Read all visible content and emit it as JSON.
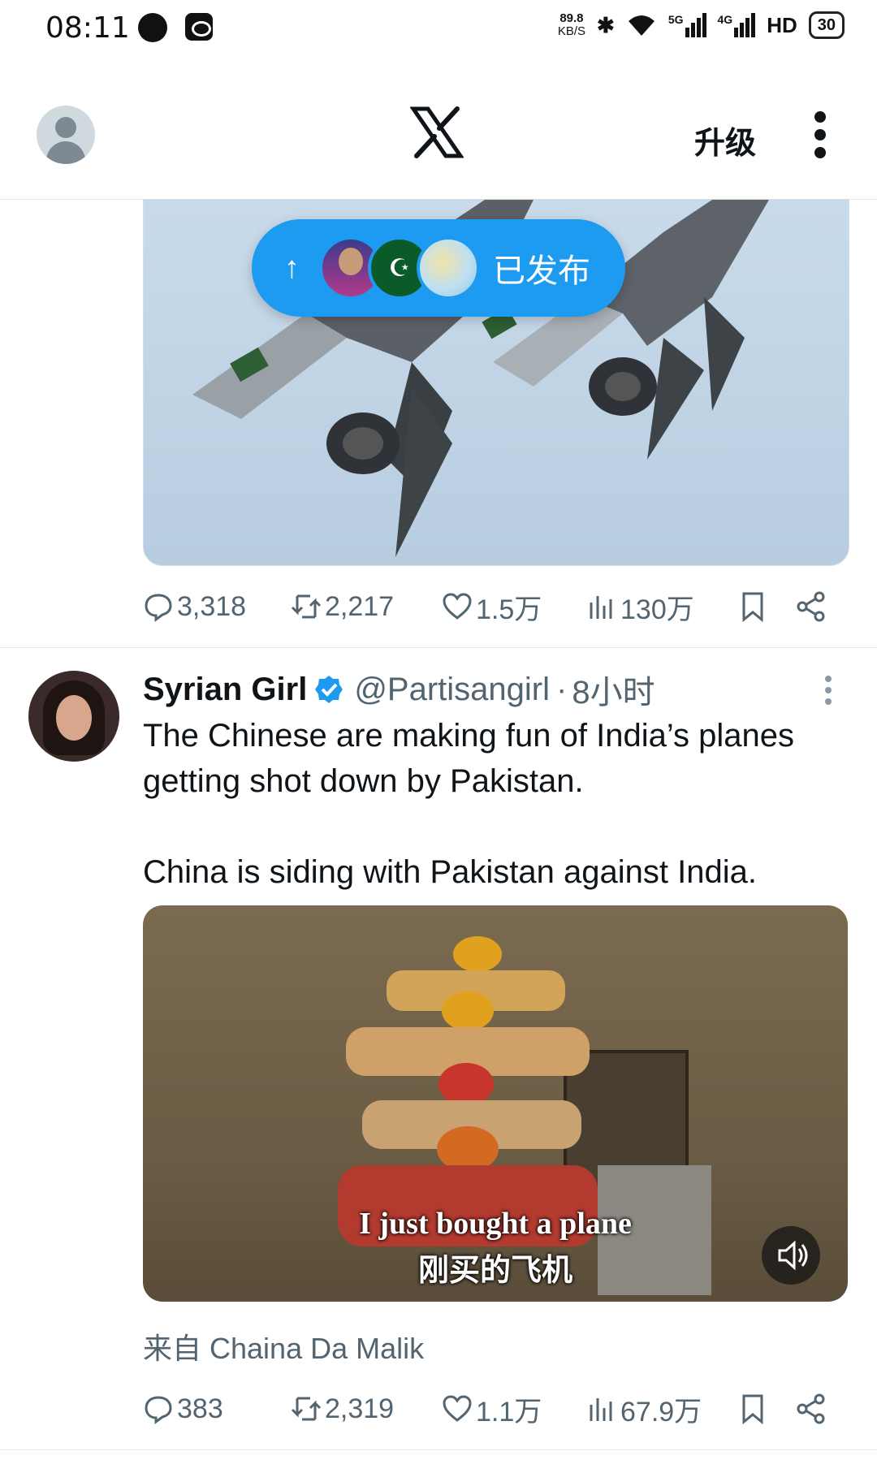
{
  "status_bar": {
    "time": "08:11",
    "net_speed_value": "89.8",
    "net_speed_unit": "KB/S",
    "network_5g": "5G",
    "network_4g": "4G",
    "hd": "HD",
    "battery": "30"
  },
  "header": {
    "upgrade_label": "升级",
    "icons": [
      "avatar-icon",
      "x-logo-icon",
      "more-vertical-icon"
    ]
  },
  "banner": {
    "label": "已发布"
  },
  "tweet1_stats": {
    "replies": "3,318",
    "retweets": "2,217",
    "likes": "1.5万",
    "views": "130万"
  },
  "tweet2": {
    "name": "Syrian Girl",
    "handle": "@Partisangirl",
    "separator": "·",
    "time": "8小时",
    "text_line1": "The Chinese are making fun of India’s planes getting shot down by Pakistan.",
    "text_line2": "China is siding with Pakistan against India.",
    "subtitle_en": "I just bought a plane",
    "subtitle_zh": "刚买的飞机",
    "from_label": "来自 Chaina Da Malik",
    "stats": {
      "replies": "383",
      "retweets": "2,319",
      "likes": "1.1万",
      "views": "67.9万"
    }
  },
  "colors": {
    "accent": "#1d9bf0",
    "text": "#0f1419",
    "secondary": "#536471",
    "verified": "#1d9bf0"
  }
}
